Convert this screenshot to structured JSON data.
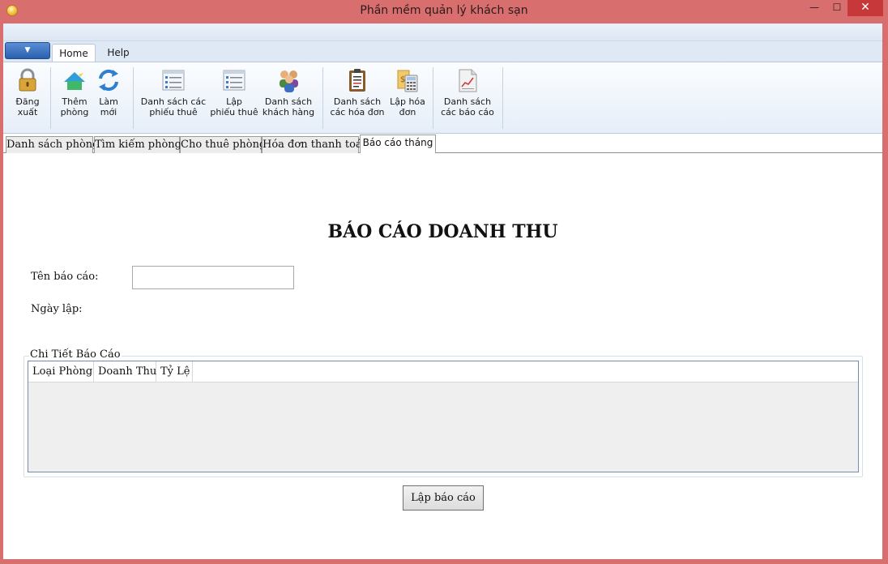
{
  "window": {
    "title": "Phần mềm quản lý khách sạn",
    "minimize_glyph": "—",
    "maximize_glyph": "☐",
    "close_glyph": "✕"
  },
  "ribbon": {
    "app_menu_glyph": "▼",
    "tabs": [
      {
        "label": "Home",
        "selected": true
      },
      {
        "label": "Help",
        "selected": false
      }
    ],
    "buttons": [
      {
        "line1": "Đăng",
        "line2": "xuất",
        "icon": "padlock-icon"
      },
      {
        "line1": "Thêm",
        "line2": "phòng",
        "icon": "add-room-icon"
      },
      {
        "line1": "Làm",
        "line2": "mới",
        "icon": "refresh-icon"
      },
      {
        "line1": "Danh sách các",
        "line2": "phiếu thuê",
        "icon": "rental-list-icon"
      },
      {
        "line1": "Lập",
        "line2": "phiếu thuê",
        "icon": "rental-form-icon"
      },
      {
        "line1": "Danh sách",
        "line2": "khách hàng",
        "icon": "customers-icon"
      },
      {
        "line1": "Danh sách",
        "line2": "các hóa đơn",
        "icon": "clipboard-icon"
      },
      {
        "line1": "Lập hóa",
        "line2": "đơn",
        "icon": "calculator-icon"
      },
      {
        "line1": "Danh sách",
        "line2": "các báo cáo",
        "icon": "report-chart-icon"
      }
    ]
  },
  "main_tabs": [
    {
      "label": "Danh sách phòng",
      "selected": false
    },
    {
      "label": "Tìm kiếm phòng",
      "selected": false
    },
    {
      "label": "Cho thuê phòng",
      "selected": false
    },
    {
      "label": "Hóa đơn thanh toán",
      "selected": false
    },
    {
      "label": "Báo cáo tháng",
      "selected": true
    }
  ],
  "report": {
    "title": "BÁO CÁO DOANH THU",
    "name_label": "Tên báo cáo:",
    "name_value": "",
    "date_label": "Ngày lập:",
    "details_legend": "Chi Tiết Báo Cáo",
    "columns": [
      "Loại Phòng",
      "Doanh Thu",
      "Tỷ Lệ"
    ],
    "rows": [],
    "submit_label": "Lập báo cáo"
  },
  "colors": {
    "titlebar": "#d86e6e",
    "close_button": "#c7383a",
    "ribbon_bg": "#dfe9f5"
  }
}
